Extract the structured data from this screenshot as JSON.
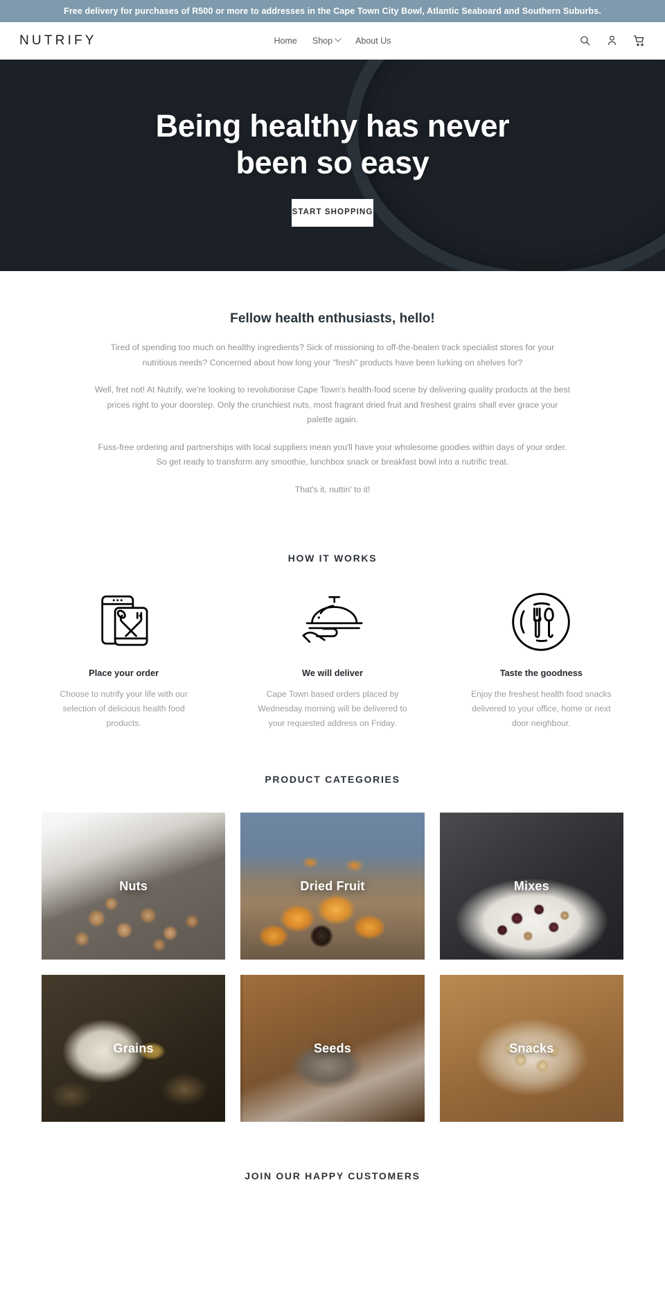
{
  "announcement": {
    "text": "Free delivery for purchases of R500 or more to addresses in the Cape Town City Bowl, Atlantic Seaboard and Southern Suburbs.",
    "background": "#7e9aac"
  },
  "header": {
    "logo": "NUTRIFY",
    "nav": [
      {
        "label": "Home",
        "has_caret": false
      },
      {
        "label": "Shop",
        "has_caret": true
      },
      {
        "label": "About Us",
        "has_caret": false
      }
    ],
    "icons": [
      {
        "name": "search-icon",
        "label": "Search"
      },
      {
        "name": "account-icon",
        "label": "Account"
      },
      {
        "name": "cart-icon",
        "label": "Cart"
      }
    ]
  },
  "hero": {
    "title": "Being healthy has never been so easy",
    "cta_label": "START SHOPPING"
  },
  "intro": {
    "heading": "Fellow health enthusiasts, hello!",
    "paragraphs": [
      "Tired of spending too much on healthy ingredients? Sick of missioning to off-the-beaten track specialist stores for your nutritious needs? Concerned about how long your \"fresh\" products have been lurking on shelves for?",
      "Well, fret not! At Nutrify, we're looking to revolutionise Cape Town's health-food scene by delivering quality products at the best prices right to your doorstep. Only the crunchiest nuts, most fragrant dried fruit and freshest grains shall ever grace your palette again.",
      "Fuss-free ordering and partnerships with local suppliers mean you'll have your wholesome goodies within days of your order. So get ready to transform any smoothie, lunchbox snack or breakfast bowl into a nutrific treat.",
      "That's it, nuttin' to it!"
    ]
  },
  "how_it_works": {
    "heading": "HOW IT WORKS",
    "steps": [
      {
        "icon": "phone-order-icon",
        "title": "Place your order",
        "description": "Choose to nutrify your life with our selection of delicious health food products."
      },
      {
        "icon": "food-dome-delivery-icon",
        "title": "We will deliver",
        "description": "Cape Town based orders placed by Wednesday morning will be delivered to your requested address on Friday."
      },
      {
        "icon": "plate-cutlery-icon",
        "title": "Taste the goodness",
        "description": "Enjoy the freshest health food snacks delivered to your office, home or next door neighbour."
      }
    ]
  },
  "categories": {
    "heading": "PRODUCT CATEGORIES",
    "items": [
      {
        "label": "Nuts",
        "photo": "ph-nuts"
      },
      {
        "label": "Dried Fruit",
        "photo": "ph-dried"
      },
      {
        "label": "Mixes",
        "photo": "ph-mixes"
      },
      {
        "label": "Grains",
        "photo": "ph-grains"
      },
      {
        "label": "Seeds",
        "photo": "ph-seeds"
      },
      {
        "label": "Snacks",
        "photo": "ph-snacks"
      }
    ]
  },
  "join": {
    "heading": "JOIN OUR HAPPY CUSTOMERS"
  }
}
